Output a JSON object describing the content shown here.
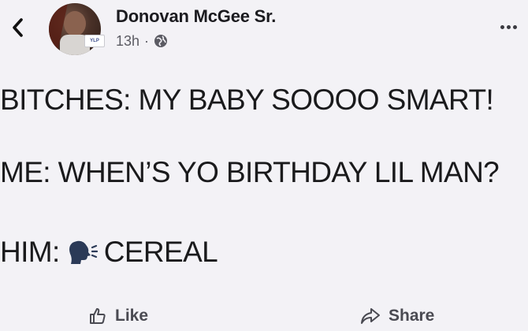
{
  "header": {
    "author_name": "Donovan McGee Sr.",
    "timestamp": "13h",
    "separator": "·",
    "privacy_icon": "globe-icon",
    "back_icon": "chevron-left-icon",
    "more_icon": "ellipsis-icon"
  },
  "post": {
    "lines": [
      "BITCHES: MY BABY SOOOO SMART!",
      "ME: WHEN’S YO BIRTHDAY LIL MAN?",
      "HIM:",
      "CEREAL"
    ],
    "emoji_icon": "speaking-head-icon"
  },
  "actions": {
    "like_label": "Like",
    "share_label": "Share"
  }
}
